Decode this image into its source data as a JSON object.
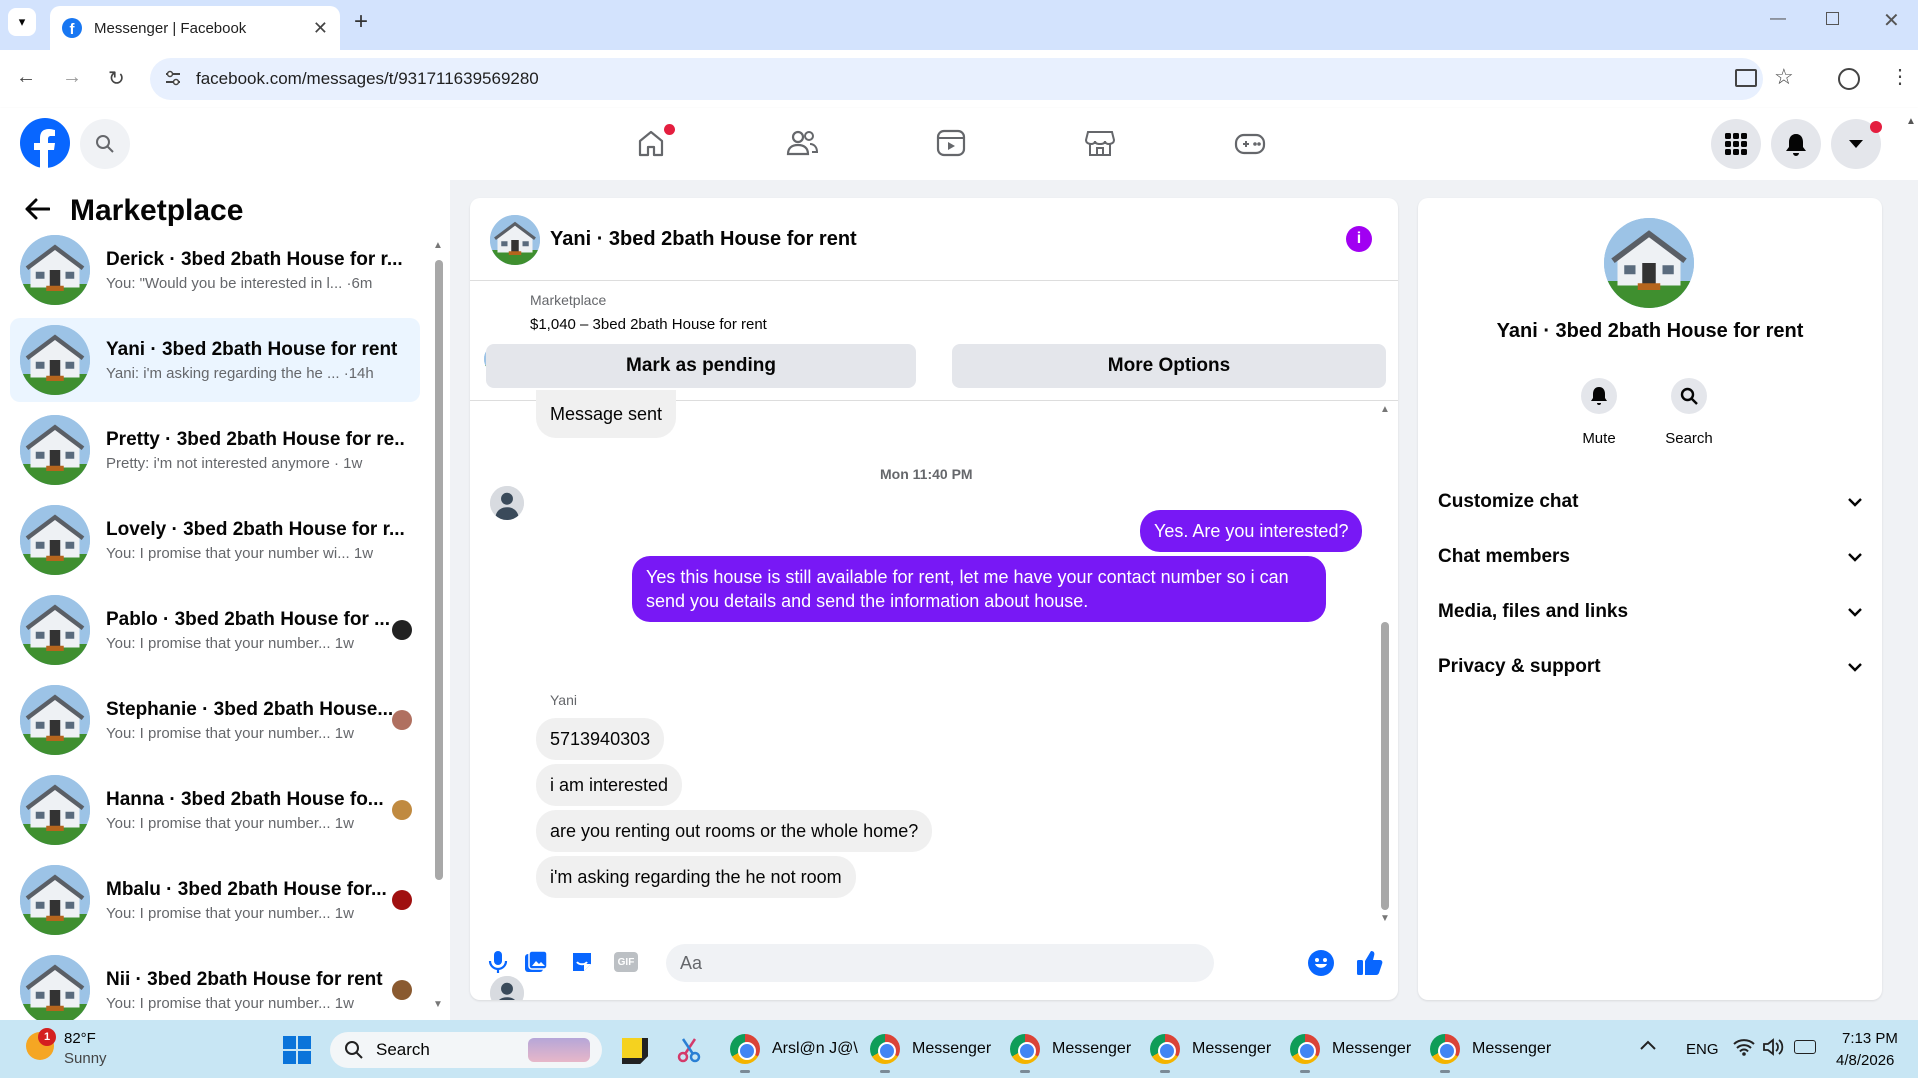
{
  "browser": {
    "tab_title": "Messenger | Facebook",
    "url": "facebook.com/messages/t/931711639569280",
    "new_tab": "+"
  },
  "fb": {
    "home_badge": true,
    "menu_badge": true
  },
  "left": {
    "title": "Marketplace",
    "conversations": [
      {
        "name": "Derick · 3bed 2bath House for r...",
        "preview": "You: \"Would you be interested in l...  ·6m",
        "seen": "",
        "active": false
      },
      {
        "name": "Yani · 3bed 2bath House for rent",
        "preview": "Yani: i'm asking regarding the he ...  ·14h",
        "seen": "",
        "active": true
      },
      {
        "name": "Pretty · 3bed 2bath House for re...",
        "preview": "Pretty: i'm not interested anymore · 1w",
        "seen": "",
        "active": false
      },
      {
        "name": "Lovely · 3bed 2bath House for r...",
        "preview": "You: I promise that your number wi...  1w",
        "seen": "",
        "active": false
      },
      {
        "name": "Pablo · 3bed 2bath House for ...",
        "preview": "You: I promise that your number...  1w",
        "seen": "#222",
        "active": false
      },
      {
        "name": "Stephanie · 3bed 2bath House...",
        "preview": "You: I promise that your number...  1w",
        "seen": "#b07060",
        "active": false
      },
      {
        "name": "Hanna · 3bed 2bath House fo...",
        "preview": "You: I promise that your number...  1w",
        "seen": "#c08a40",
        "active": false
      },
      {
        "name": "Mbalu · 3bed 2bath House for...",
        "preview": "You: I promise that your number...  1w",
        "seen": "#a01010",
        "active": false
      },
      {
        "name": "Nii · 3bed 2bath House for rent",
        "preview": "You: I promise that your number...  1w",
        "seen": "#8a5a30",
        "active": false
      }
    ]
  },
  "chat": {
    "title": "Yani · 3bed 2bath House for rent",
    "listing_source": "Marketplace",
    "listing_line": "$1,040 – 3bed 2bath House for rent",
    "mark_pending": "Mark as pending",
    "more_options": "More Options",
    "msg_sent": "Message sent",
    "timestamp": "Mon 11:40 PM",
    "out_1": "Yes. Are you interested?",
    "out_2": "Yes this house is still available for rent, let me have your contact number so i can send you details and send the information about house.",
    "sender": "Yani",
    "in_1": "5713940303",
    "in_2": "i am interested",
    "in_3": "are you renting out rooms or the whole home?",
    "in_4": "i'm asking regarding the he not room",
    "composer_placeholder": "Aa",
    "accent": "#7818f5"
  },
  "info": {
    "name": "Yani · 3bed 2bath House for rent",
    "mute": "Mute",
    "search": "Search",
    "rows": [
      "Customize chat",
      "Chat members",
      "Media, files and links",
      "Privacy & support"
    ]
  },
  "taskbar": {
    "weather_temp": "82°F",
    "weather_desc": "Sunny",
    "weather_badge": "1",
    "search": "Search",
    "apps": [
      "Arsl@n J@\\",
      "Messenger",
      "Messenger",
      "Messenger",
      "Messenger",
      "Messenger"
    ],
    "lang": "ENG",
    "time": "7:13 PM",
    "date": "4/8/2026"
  }
}
